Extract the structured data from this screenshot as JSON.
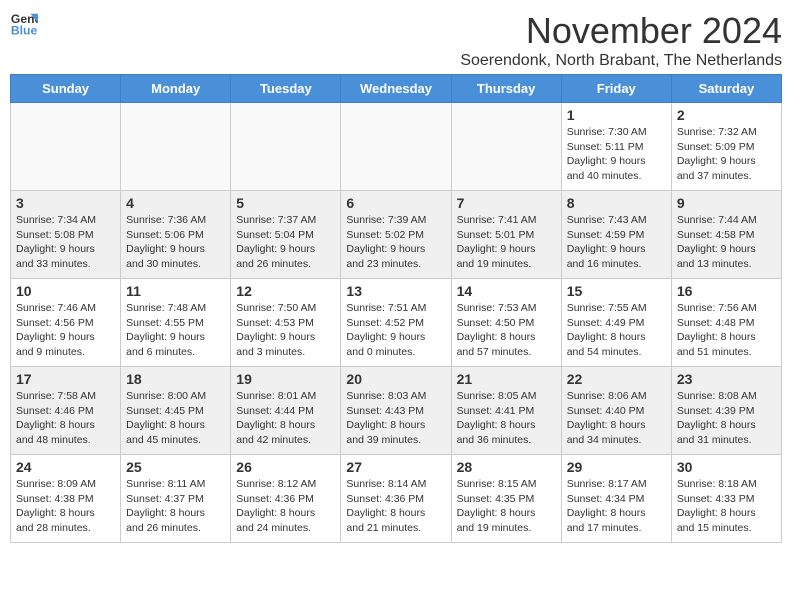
{
  "logo": {
    "line1": "General",
    "line2": "Blue"
  },
  "title": "November 2024",
  "subtitle": "Soerendonk, North Brabant, The Netherlands",
  "days_of_week": [
    "Sunday",
    "Monday",
    "Tuesday",
    "Wednesday",
    "Thursday",
    "Friday",
    "Saturday"
  ],
  "weeks": [
    [
      {
        "day": "",
        "info": "",
        "shade": false
      },
      {
        "day": "",
        "info": "",
        "shade": false
      },
      {
        "day": "",
        "info": "",
        "shade": false
      },
      {
        "day": "",
        "info": "",
        "shade": false
      },
      {
        "day": "",
        "info": "",
        "shade": false
      },
      {
        "day": "1",
        "info": "Sunrise: 7:30 AM\nSunset: 5:11 PM\nDaylight: 9 hours\nand 40 minutes.",
        "shade": false
      },
      {
        "day": "2",
        "info": "Sunrise: 7:32 AM\nSunset: 5:09 PM\nDaylight: 9 hours\nand 37 minutes.",
        "shade": false
      }
    ],
    [
      {
        "day": "3",
        "info": "Sunrise: 7:34 AM\nSunset: 5:08 PM\nDaylight: 9 hours\nand 33 minutes.",
        "shade": true
      },
      {
        "day": "4",
        "info": "Sunrise: 7:36 AM\nSunset: 5:06 PM\nDaylight: 9 hours\nand 30 minutes.",
        "shade": true
      },
      {
        "day": "5",
        "info": "Sunrise: 7:37 AM\nSunset: 5:04 PM\nDaylight: 9 hours\nand 26 minutes.",
        "shade": true
      },
      {
        "day": "6",
        "info": "Sunrise: 7:39 AM\nSunset: 5:02 PM\nDaylight: 9 hours\nand 23 minutes.",
        "shade": true
      },
      {
        "day": "7",
        "info": "Sunrise: 7:41 AM\nSunset: 5:01 PM\nDaylight: 9 hours\nand 19 minutes.",
        "shade": true
      },
      {
        "day": "8",
        "info": "Sunrise: 7:43 AM\nSunset: 4:59 PM\nDaylight: 9 hours\nand 16 minutes.",
        "shade": true
      },
      {
        "day": "9",
        "info": "Sunrise: 7:44 AM\nSunset: 4:58 PM\nDaylight: 9 hours\nand 13 minutes.",
        "shade": true
      }
    ],
    [
      {
        "day": "10",
        "info": "Sunrise: 7:46 AM\nSunset: 4:56 PM\nDaylight: 9 hours\nand 9 minutes.",
        "shade": false
      },
      {
        "day": "11",
        "info": "Sunrise: 7:48 AM\nSunset: 4:55 PM\nDaylight: 9 hours\nand 6 minutes.",
        "shade": false
      },
      {
        "day": "12",
        "info": "Sunrise: 7:50 AM\nSunset: 4:53 PM\nDaylight: 9 hours\nand 3 minutes.",
        "shade": false
      },
      {
        "day": "13",
        "info": "Sunrise: 7:51 AM\nSunset: 4:52 PM\nDaylight: 9 hours\nand 0 minutes.",
        "shade": false
      },
      {
        "day": "14",
        "info": "Sunrise: 7:53 AM\nSunset: 4:50 PM\nDaylight: 8 hours\nand 57 minutes.",
        "shade": false
      },
      {
        "day": "15",
        "info": "Sunrise: 7:55 AM\nSunset: 4:49 PM\nDaylight: 8 hours\nand 54 minutes.",
        "shade": false
      },
      {
        "day": "16",
        "info": "Sunrise: 7:56 AM\nSunset: 4:48 PM\nDaylight: 8 hours\nand 51 minutes.",
        "shade": false
      }
    ],
    [
      {
        "day": "17",
        "info": "Sunrise: 7:58 AM\nSunset: 4:46 PM\nDaylight: 8 hours\nand 48 minutes.",
        "shade": true
      },
      {
        "day": "18",
        "info": "Sunrise: 8:00 AM\nSunset: 4:45 PM\nDaylight: 8 hours\nand 45 minutes.",
        "shade": true
      },
      {
        "day": "19",
        "info": "Sunrise: 8:01 AM\nSunset: 4:44 PM\nDaylight: 8 hours\nand 42 minutes.",
        "shade": true
      },
      {
        "day": "20",
        "info": "Sunrise: 8:03 AM\nSunset: 4:43 PM\nDaylight: 8 hours\nand 39 minutes.",
        "shade": true
      },
      {
        "day": "21",
        "info": "Sunrise: 8:05 AM\nSunset: 4:41 PM\nDaylight: 8 hours\nand 36 minutes.",
        "shade": true
      },
      {
        "day": "22",
        "info": "Sunrise: 8:06 AM\nSunset: 4:40 PM\nDaylight: 8 hours\nand 34 minutes.",
        "shade": true
      },
      {
        "day": "23",
        "info": "Sunrise: 8:08 AM\nSunset: 4:39 PM\nDaylight: 8 hours\nand 31 minutes.",
        "shade": true
      }
    ],
    [
      {
        "day": "24",
        "info": "Sunrise: 8:09 AM\nSunset: 4:38 PM\nDaylight: 8 hours\nand 28 minutes.",
        "shade": false
      },
      {
        "day": "25",
        "info": "Sunrise: 8:11 AM\nSunset: 4:37 PM\nDaylight: 8 hours\nand 26 minutes.",
        "shade": false
      },
      {
        "day": "26",
        "info": "Sunrise: 8:12 AM\nSunset: 4:36 PM\nDaylight: 8 hours\nand 24 minutes.",
        "shade": false
      },
      {
        "day": "27",
        "info": "Sunrise: 8:14 AM\nSunset: 4:36 PM\nDaylight: 8 hours\nand 21 minutes.",
        "shade": false
      },
      {
        "day": "28",
        "info": "Sunrise: 8:15 AM\nSunset: 4:35 PM\nDaylight: 8 hours\nand 19 minutes.",
        "shade": false
      },
      {
        "day": "29",
        "info": "Sunrise: 8:17 AM\nSunset: 4:34 PM\nDaylight: 8 hours\nand 17 minutes.",
        "shade": false
      },
      {
        "day": "30",
        "info": "Sunrise: 8:18 AM\nSunset: 4:33 PM\nDaylight: 8 hours\nand 15 minutes.",
        "shade": false
      }
    ]
  ]
}
